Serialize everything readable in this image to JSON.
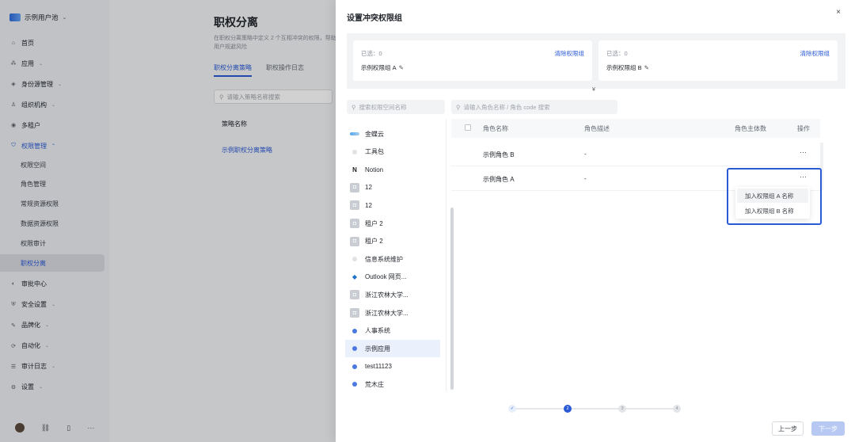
{
  "sidebar": {
    "pool_name": "示例用户池",
    "items": [
      {
        "label": "首页",
        "icon": "home-icon",
        "glyph": "⌂",
        "chevron": false
      },
      {
        "label": "应用",
        "icon": "apps-icon",
        "glyph": "⁂",
        "chevron": true
      },
      {
        "label": "身份源管理",
        "icon": "identity-icon",
        "glyph": "◈",
        "chevron": true
      },
      {
        "label": "组织机构",
        "icon": "org-icon",
        "glyph": "♙",
        "chevron": true
      },
      {
        "label": "多租户",
        "icon": "tenant-icon",
        "glyph": "◉",
        "chevron": false
      },
      {
        "label": "权限管理",
        "icon": "permission-icon",
        "glyph": "⛉",
        "chevron": true
      }
    ],
    "sub_items": [
      "权限空间",
      "角色管理",
      "常规资源权限",
      "数据资源权限",
      "权限审计",
      "职权分离"
    ],
    "items_after": [
      {
        "label": "审批中心",
        "icon": "approval-icon",
        "glyph": "◐",
        "chevron": false
      },
      {
        "label": "安全设置",
        "icon": "security-icon",
        "glyph": "⛨",
        "chevron": true
      },
      {
        "label": "品牌化",
        "icon": "brand-icon",
        "glyph": "✎",
        "chevron": true
      },
      {
        "label": "自动化",
        "icon": "automation-icon",
        "glyph": "⟳",
        "chevron": true
      },
      {
        "label": "审计日志",
        "icon": "audit-icon",
        "glyph": "☰",
        "chevron": true
      },
      {
        "label": "设置",
        "icon": "settings-icon",
        "glyph": "⚙",
        "chevron": true
      }
    ]
  },
  "page": {
    "title": "职权分离",
    "description": "在职权分离策略中定义 2 个互相冲突的权限，帮助用户规避风险",
    "tabs": [
      "职权分离策略",
      "职权操作日志"
    ],
    "search_placeholder": "请输入策略名称搜索",
    "column_header": "策略名称",
    "policy_link": "示例职权分离策略"
  },
  "modal": {
    "title": "设置冲突权限组",
    "close": "×",
    "group_a": {
      "selected": "已选：0",
      "clear": "清除权限组",
      "name": "示例权限组 A"
    },
    "group_b": {
      "selected": "已选：0",
      "clear": "清除权限组",
      "name": "示例权限组 B"
    },
    "expand": "¥",
    "left_search_placeholder": "搜索权限空间名称",
    "right_search_placeholder": "请输入角色名称 / 角色 code 搜索",
    "apps": [
      {
        "name": "金蝶云",
        "icon": "kingdee"
      },
      {
        "name": "工具包",
        "icon": "light"
      },
      {
        "name": "Notion",
        "icon": "notion"
      },
      {
        "name": "12",
        "icon": "grey"
      },
      {
        "name": "12",
        "icon": "grey"
      },
      {
        "name": "租户 2",
        "icon": "grey"
      },
      {
        "name": "租户 2",
        "icon": "grey"
      },
      {
        "name": "信息系统维护",
        "icon": "light"
      },
      {
        "name": "Outlook 网页...",
        "icon": "outlook"
      },
      {
        "name": "浙江农林大学...",
        "icon": "grey"
      },
      {
        "name": "浙江农林大学...",
        "icon": "grey"
      },
      {
        "name": "人事系统",
        "icon": "dot"
      },
      {
        "name": "示例应用",
        "icon": "dot"
      },
      {
        "name": "test11123",
        "icon": "dot"
      },
      {
        "name": "荒木庄",
        "icon": "dot"
      }
    ],
    "active_app_index": 12,
    "table": {
      "headers": {
        "name": "角色名称",
        "desc": "角色描述",
        "subjects": "角色主体数",
        "ops": "操作"
      },
      "rows": [
        {
          "name": "示例角色 B",
          "desc": "-",
          "more": "···"
        },
        {
          "name": "示例角色 A",
          "desc": "-",
          "more": "···"
        }
      ]
    },
    "menu": [
      "加入权限组 A 名称",
      "加入权限组 B 名称"
    ],
    "steps": [
      "✓",
      "2",
      "3",
      "4"
    ],
    "current_step": 2,
    "prev_button": "上一步",
    "next_button": "下一步"
  }
}
